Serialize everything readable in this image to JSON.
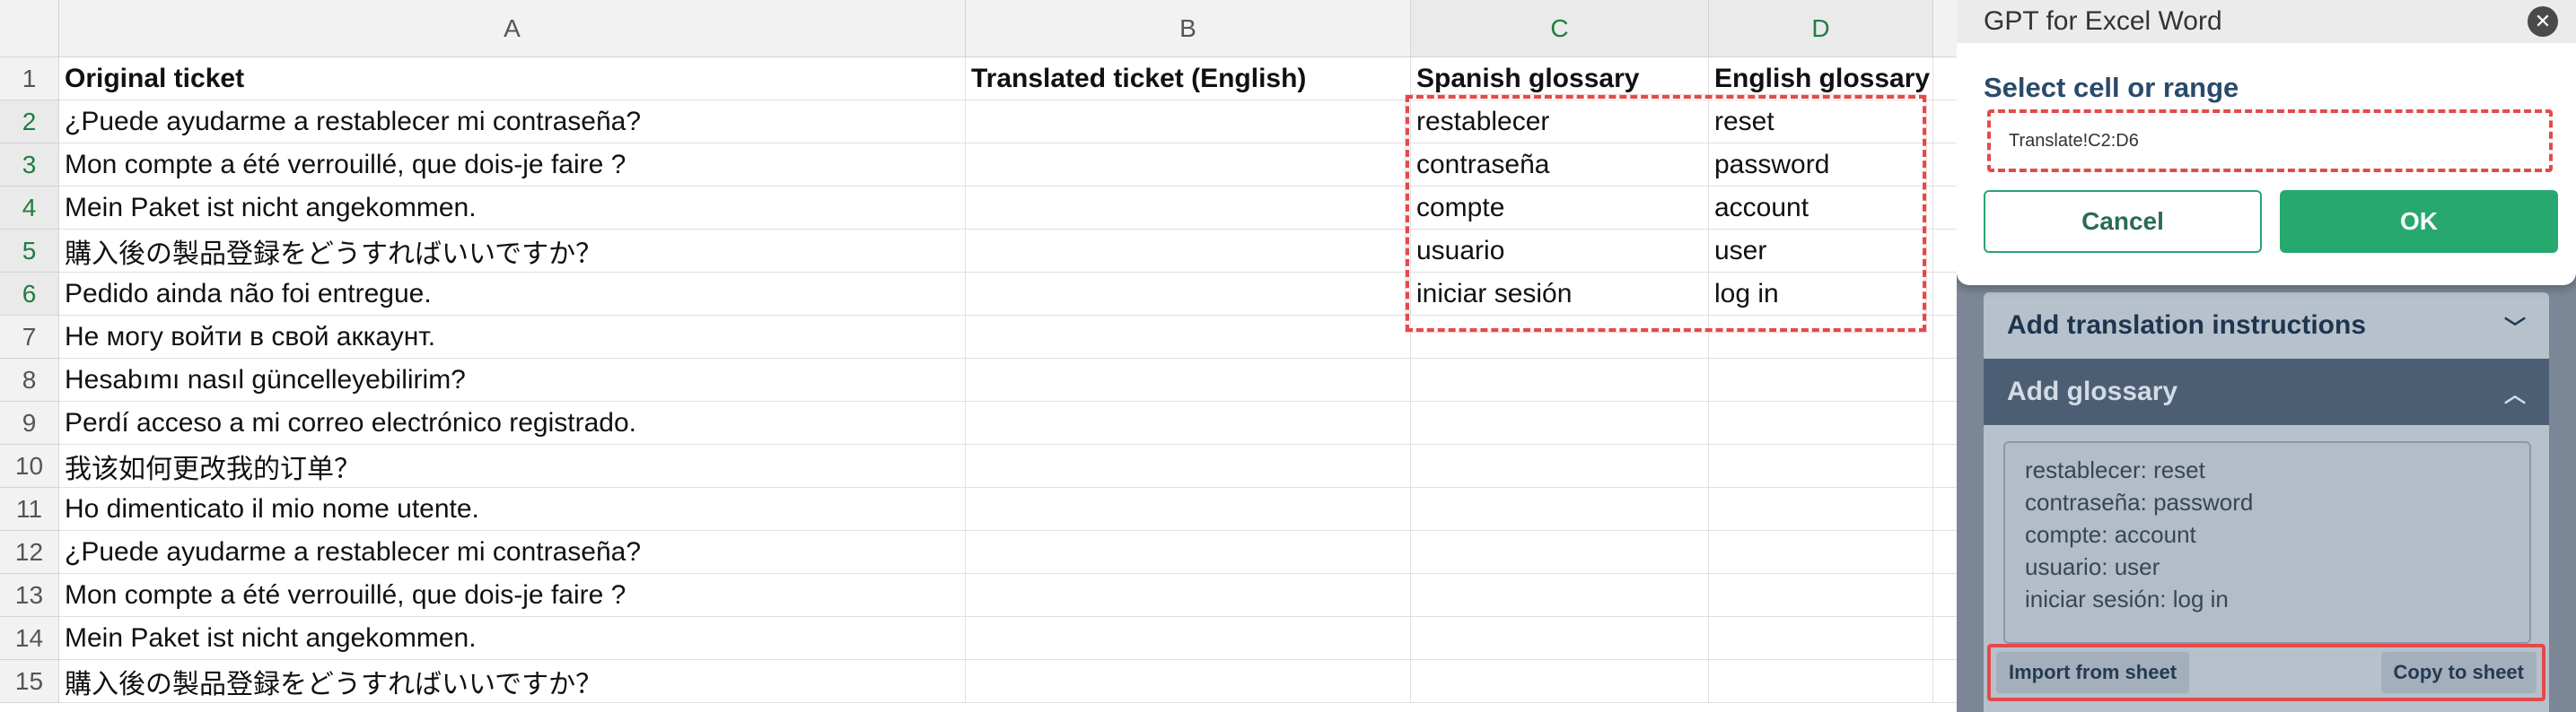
{
  "sheet": {
    "columns": [
      "A",
      "B",
      "C",
      "D"
    ],
    "headers": {
      "A": "Original ticket",
      "B": "Translated ticket (English)",
      "C": "Spanish glossary",
      "D": "English glossary"
    },
    "rows": [
      {
        "n": "1"
      },
      {
        "n": "2",
        "a": "¿Puede ayudarme a restablecer mi contraseña?",
        "c": "restablecer",
        "d": "reset"
      },
      {
        "n": "3",
        "a": "Mon compte a été verrouillé, que dois-je faire ?",
        "c": "contraseña",
        "d": "password"
      },
      {
        "n": "4",
        "a": "Mein Paket ist nicht angekommen.",
        "c": "compte",
        "d": "account"
      },
      {
        "n": "5",
        "a": "購入後の製品登録をどうすればいいですか？",
        "c": "usuario",
        "d": "user"
      },
      {
        "n": "6",
        "a": "Pedido ainda não foi entregue.",
        "c": "iniciar sesión",
        "d": "log in"
      },
      {
        "n": "7",
        "a": "Не могу войти в свой аккаунт."
      },
      {
        "n": "8",
        "a": "Hesabımı nasıl güncelleyebilirim?"
      },
      {
        "n": "9",
        "a": "Perdí acceso a mi correo electrónico registrado."
      },
      {
        "n": "10",
        "a": "我该如何更改我的订单？"
      },
      {
        "n": "11",
        "a": "Ho dimenticato il mio nome utente."
      },
      {
        "n": "12",
        "a": "¿Puede ayudarme a restablecer mi contraseña?"
      },
      {
        "n": "13",
        "a": "Mon compte a été verrouillé, que dois-je faire ?"
      },
      {
        "n": "14",
        "a": "Mein Paket ist nicht angekommen."
      },
      {
        "n": "15",
        "a": "購入後の製品登録をどうすればいいですか？"
      }
    ],
    "selection": "C2:D6"
  },
  "dialog": {
    "title": "GPT for Excel Word",
    "select_label": "Select cell or range",
    "range_value": "Translate!C2:D6",
    "cancel_label": "Cancel",
    "ok_label": "OK"
  },
  "panel": {
    "instructions_label": "Add translation instructions",
    "glossary_label": "Add glossary",
    "glossary_lines": [
      "restablecer: reset",
      "contraseña: password",
      "compte: account",
      "usuario: user",
      "iniciar sesión: log in"
    ],
    "import_label": "Import from sheet",
    "copy_label": "Copy to sheet"
  },
  "icons": {
    "close": "close-icon",
    "chevron_down": "chevron-down-icon",
    "chevron_up": "chevron-up-icon"
  },
  "colors": {
    "accent_green": "#27a86e",
    "selection_red": "#e34a4a",
    "panel_dark": "#4c5e74"
  }
}
